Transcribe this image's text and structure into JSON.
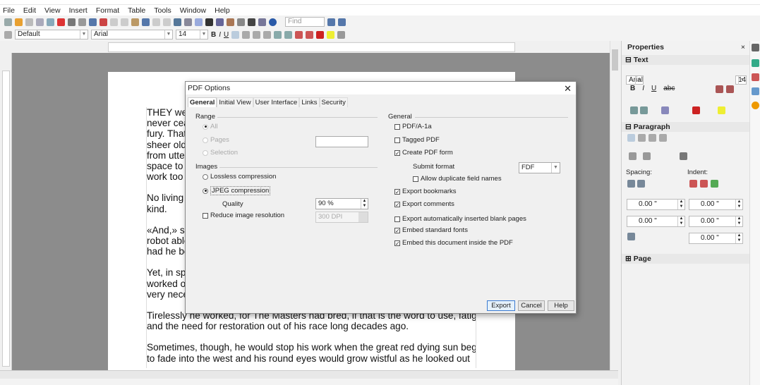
{
  "menu": [
    "File",
    "Edit",
    "View",
    "Insert",
    "Format",
    "Table",
    "Tools",
    "Window",
    "Help"
  ],
  "toolbar": {
    "find_placeholder": "Find",
    "paragraph_style": "Default",
    "font_name": "Arial",
    "font_size": "14"
  },
  "document": {
    "fragments": [
      "THEY we",
      "never cea",
      "fury. That",
      "sheer old",
      "from utter",
      "space to l",
      "work too",
      "No living",
      "kind.",
      "«And,» sc",
      "robot able",
      "had he be",
      "Yet, in spi",
      "worked o",
      "very nece"
    ],
    "paragraphs": [
      "Tirelessly he worked, for The Masters had bred, if that is the word to use, fatigue",
      "and the need for restoration out of his race long decades ago.",
      "Sometimes, though, he would stop his work when the great red dying sun began",
      "to fade into the west and his round eyes would grow wistful as he looked out"
    ]
  },
  "sidebar": {
    "title": "Properties",
    "text_section": "Text",
    "font_name": "Arial",
    "font_size": "14",
    "paragraph_section": "Paragraph",
    "spacing_label": "Spacing:",
    "indent_label": "Indent:",
    "spacing_above": "0.00 \"",
    "spacing_below": "0.00 \"",
    "indent_before": "0.00 \"",
    "indent_after": "0.00 \"",
    "indent_first": "0.00 \"",
    "page_section": "Page"
  },
  "dialog": {
    "title": "PDF Options",
    "tabs": [
      "General",
      "Initial View",
      "User Interface",
      "Links",
      "Security"
    ],
    "range": {
      "label": "Range",
      "all": "All",
      "pages": "Pages",
      "selection": "Selection",
      "pages_value": ""
    },
    "images": {
      "label": "Images",
      "lossless": "Lossless compression",
      "jpeg": "JPEG compression",
      "quality_label": "Quality",
      "quality_value": "90 %",
      "reduce": "Reduce image resolution",
      "resolution_value": "300 DPI"
    },
    "general": {
      "label": "General",
      "pdfa": "PDF/A-1a",
      "tagged": "Tagged PDF",
      "create_form": "Create PDF form",
      "submit_format_label": "Submit format",
      "submit_format_value": "FDF",
      "allow_duplicate": "Allow duplicate field names",
      "export_bookmarks": "Export bookmarks",
      "export_comments": "Export comments",
      "export_blank": "Export automatically inserted blank pages",
      "embed_fonts": "Embed standard fonts",
      "embed_document": "Embed this document inside the PDF"
    },
    "buttons": {
      "export": "Export",
      "cancel": "Cancel",
      "help": "Help"
    }
  }
}
